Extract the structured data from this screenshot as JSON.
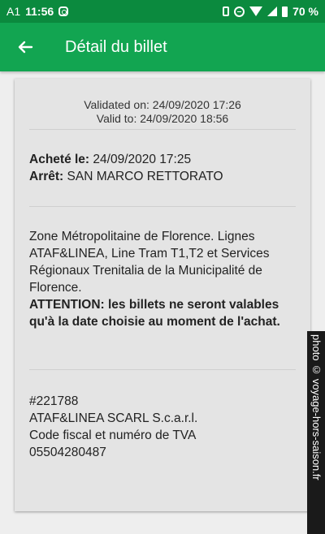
{
  "status_bar": {
    "carrier": "A1",
    "time": "11:56",
    "battery": "70 %",
    "icons": [
      "instagram-icon",
      "vibrate-icon",
      "dnd-icon",
      "wifi-icon",
      "signal-icon",
      "battery-icon"
    ]
  },
  "app_bar": {
    "back_icon": "arrow-left-icon",
    "title": "Détail du billet"
  },
  "ticket": {
    "validated_label": "Validated on:",
    "validated_value": "24/09/2020 17:26",
    "valid_to_label": "Valid to:",
    "valid_to_value": "24/09/2020 18:56",
    "purchase_label": "Acheté le:",
    "purchase_value": "24/09/2020 17:25",
    "stop_label": "Arrêt:",
    "stop_value": "SAN MARCO RETTORATO",
    "zone_text": "Zone Métropolitaine de Florence. Lignes ATAF&LINEA, Line Tram T1,T2 et Services Régionaux Trenitalia de la Municipalité de Florence.",
    "warning_text": "ATTENTION: les billets ne seront valables qu'à la date choisie au moment de l'achat.",
    "ticket_number": "#221788",
    "company": "ATAF&LINEA SCARL S.c.a.r.l.",
    "fiscal_label": "Code fiscal et numéro de TVA",
    "fiscal_number": "05504280487"
  },
  "watermark": "photo © voyage-hors-saison.fr",
  "colors": {
    "status_bar": "#0b8a3e",
    "app_bar": "#12a551",
    "card": "#e4e4e4",
    "background": "#eeeeee"
  }
}
